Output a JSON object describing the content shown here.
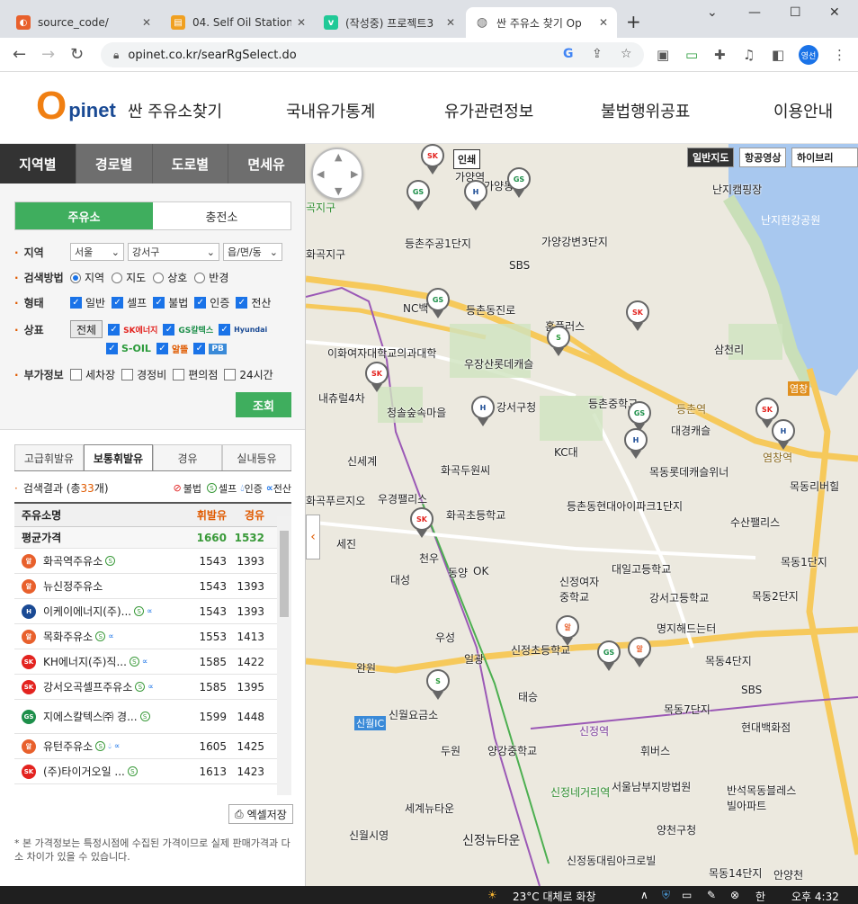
{
  "browser": {
    "tabs": [
      {
        "title": "source_code/",
        "icon": "source-icon",
        "color": "#e8602c"
      },
      {
        "title": "04. Self Oil Station",
        "icon": "notebook-icon",
        "color": "#f0a020"
      },
      {
        "title": "(작성중) 프로젝트3",
        "icon": "velog-icon",
        "color": "#20c997"
      },
      {
        "title": "싼 주유소 찾기 Op",
        "icon": "globe-icon",
        "color": "#777777"
      }
    ],
    "url": "opinet.co.kr/searRgSelect.do",
    "profile": "영선"
  },
  "header": {
    "logo_o": "O",
    "logo_text": "pinet",
    "nav": [
      "싼 주유소찾기",
      "국내유가통계",
      "유가관련정보",
      "불법행위공표",
      "이용안내"
    ]
  },
  "sidebar": {
    "main_tabs": [
      "지역별",
      "경로별",
      "도로별",
      "면세유"
    ],
    "sub_tabs": [
      "주유소",
      "충전소"
    ],
    "region": {
      "label": "지역",
      "sido": "서울",
      "sigungu": "강서구",
      "dong": "읍/면/동"
    },
    "method": {
      "label": "검색방법",
      "options": [
        "지역",
        "지도",
        "상호",
        "반경"
      ]
    },
    "type": {
      "label": "형태",
      "options": [
        "일반",
        "셀프",
        "불법",
        "인증",
        "전산"
      ]
    },
    "brand": {
      "label": "상표",
      "all": "전체",
      "logos": [
        "SK에너지",
        "GS칼텍스",
        "Hyundai Oilbank",
        "S-OIL",
        "알뜰",
        "PB"
      ]
    },
    "extra": {
      "label": "부가정보",
      "options": [
        "세차장",
        "경정비",
        "편의점",
        "24시간"
      ]
    },
    "search_button": "조회",
    "fuel_tabs": [
      "고급휘발유",
      "보통휘발유",
      "경유",
      "실내등유"
    ],
    "result": {
      "prefix": "검색결과 (총 ",
      "count": "33",
      "suffix": "개)"
    },
    "legend": {
      "illegal": "불법",
      "self": "셀프",
      "certified": "인증",
      "computerized": "전산"
    },
    "table": {
      "headers": [
        "주유소명",
        "휘발유",
        "경유"
      ],
      "average": {
        "name": "평균가격",
        "gasoline": "1660",
        "diesel": "1532"
      },
      "rows": [
        {
          "name": "화곡역주유소",
          "brand": "알뜰",
          "gasoline": "1543",
          "diesel": "1393"
        },
        {
          "name": "뉴신정주유소",
          "brand": "알뜰",
          "gasoline": "1543",
          "diesel": "1393"
        },
        {
          "name": "이케이에너지(주)...",
          "brand": "현대",
          "gasoline": "1543",
          "diesel": "1393"
        },
        {
          "name": "목화주유소",
          "brand": "알뜰",
          "gasoline": "1553",
          "diesel": "1413"
        },
        {
          "name": "KH에너지(주)직...",
          "brand": "SK",
          "gasoline": "1585",
          "diesel": "1422"
        },
        {
          "name": "강서오곡셀프주유소",
          "brand": "SK",
          "gasoline": "1585",
          "diesel": "1395"
        },
        {
          "name": "지에스칼텍스㈜ 경...",
          "brand": "GS",
          "gasoline": "1599",
          "diesel": "1448"
        },
        {
          "name": "유턴주유소",
          "brand": "알뜰",
          "gasoline": "1605",
          "diesel": "1425"
        },
        {
          "name": "(주)타이거오일 ...",
          "brand": "SK",
          "gasoline": "1613",
          "diesel": "1423"
        }
      ]
    },
    "excel_button": "엑셀저장",
    "note": "* 본 가격정보는 특정시점에 수집된 가격이므로 실제 판매가격과 다소 차이가 있을 수 있습니다."
  },
  "map": {
    "buttons": [
      "일반지도",
      "항공영상",
      "하이브리"
    ],
    "print": "인쇄",
    "labels": [
      "가양역",
      "가양동",
      "등촌주공1단지",
      "가양강변3단지",
      "난지캠핑장",
      "난지한강공원",
      "SBS",
      "NC백",
      "등촌동진로",
      "홈플러스",
      "삼천리",
      "이화여자대학교의과대학",
      "우장산롯데캐슬",
      "내츄럴4차",
      "청솔숲속마을",
      "강서구청",
      "등촌중학교",
      "등촌역",
      "대경캐슬",
      "KC대",
      "염창역",
      "신세계",
      "화곡푸르지오",
      "우경팰리스",
      "화곡두원씨",
      "목동롯데캐슬위너",
      "목동리버힐",
      "등촌동현대아이파크1단지",
      "화곡초등학교",
      "수산팰리스",
      "대일고등학교",
      "목동1단지",
      "신정여자중학교",
      "강서고등학교",
      "목동2단지",
      "명지해드는터",
      "신정초등학교",
      "목동4단지",
      "신월요금소",
      "목동7단지",
      "현대백화점",
      "신정역",
      "양강중학교",
      "휘버스",
      "신정네거리역",
      "서울남부지방법원",
      "반석목동블레스빌아파트",
      "세계뉴타운",
      "신월시영",
      "신정뉴타운",
      "양천구청",
      "신정동대림아크로빌",
      "목동14단지",
      "안양천",
      "신월IC",
      "염창",
      "SBS",
      "천우",
      "동양",
      "OK",
      "대성",
      "우성",
      "일광",
      "태승",
      "두원",
      "완원",
      "세진",
      "화곡지구",
      "곡지구"
    ]
  },
  "taskbar": {
    "weather": "23°C 대체로 화창",
    "time": "오후 4:32"
  }
}
